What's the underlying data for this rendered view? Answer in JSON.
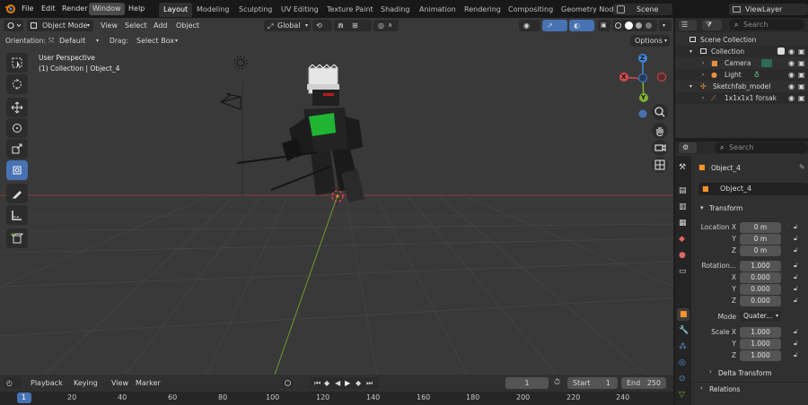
{
  "menu": {
    "items": [
      "File",
      "Edit",
      "Render",
      "Window",
      "Help"
    ],
    "workspaces": [
      "Layout",
      "Modeling",
      "Sculpting",
      "UV Editing",
      "Texture Paint",
      "Shading",
      "Animation",
      "Rendering",
      "Compositing",
      "Geometry Node"
    ],
    "scene": "Scene",
    "view_layer": "ViewLayer"
  },
  "viewport_header": {
    "mode": "Object Mode",
    "menus": [
      "View",
      "Select",
      "Add",
      "Object"
    ],
    "transform_orientation": "Global",
    "orientation_label": "Orientation:",
    "orientation_value": "Default",
    "drag_label": "Drag:",
    "drag_value": "Select Box",
    "options_label": "Options"
  },
  "viewport": {
    "perspective": "User Perspective",
    "collection_info": "(1) Collection | Object_4",
    "gizmo": {
      "x": "X",
      "y": "Y",
      "z": "Z"
    },
    "colors": {
      "x_axis": "#d64a4a",
      "y_axis": "#7fb32f",
      "z_axis": "#3d87d6",
      "selected": "#ff9429",
      "tool_active": "#4772b3"
    }
  },
  "outliner": {
    "search_placeholder": "Search",
    "rows": [
      {
        "label": "Scene Collection",
        "icon": "collection-icon"
      },
      {
        "label": "Collection",
        "icon": "collection-icon"
      },
      {
        "label": "Camera",
        "icon": "camera-icon"
      },
      {
        "label": "Light",
        "icon": "light-icon"
      },
      {
        "label": "Sketchfab_model",
        "icon": "empty-icon"
      },
      {
        "label": "1x1x1x1 forsak",
        "icon": "armature-icon"
      }
    ]
  },
  "properties": {
    "search_placeholder": "Search",
    "object_name": "Object_4",
    "object_field": "Object_4",
    "transform_title": "Transform",
    "location": {
      "label": "Location X",
      "y": "Y",
      "z": "Z",
      "values": [
        "0 m",
        "0 m",
        "0 m"
      ]
    },
    "rotation": {
      "label": "Rotation...",
      "x": "X",
      "y": "Y",
      "z": "Z",
      "values": [
        "1.000",
        "0.000",
        "0.000",
        "0.000"
      ]
    },
    "mode": {
      "label": "Mode",
      "value": "Quater..."
    },
    "scale": {
      "label": "Scale X",
      "y": "Y",
      "z": "Z",
      "values": [
        "1.000",
        "1.000",
        "1.000"
      ]
    },
    "delta_transform": "Delta Transform",
    "relations": "Relations"
  },
  "timeline": {
    "menus": [
      "Playback",
      "Keying",
      "View",
      "Marker"
    ],
    "current_frame": "1",
    "start_label": "Start",
    "start_value": "1",
    "end_label": "End",
    "end_value": "250",
    "ruler": [
      "1",
      "20",
      "40",
      "60",
      "80",
      "100",
      "120",
      "140",
      "160",
      "180",
      "200",
      "220",
      "240"
    ]
  }
}
